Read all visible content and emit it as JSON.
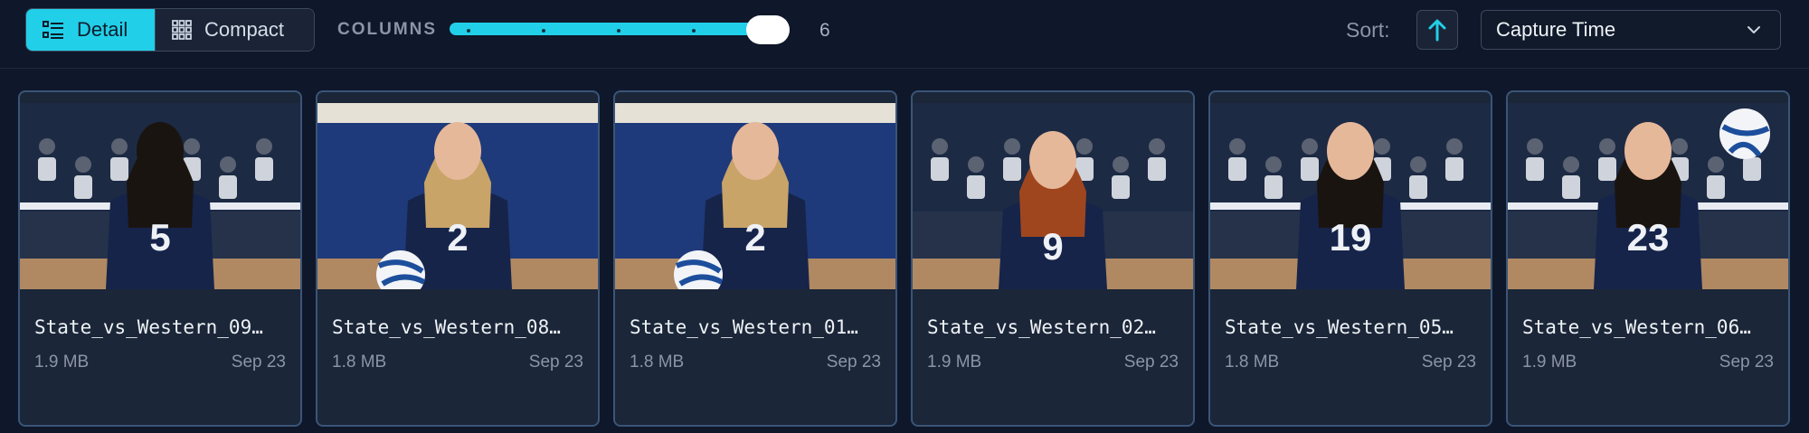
{
  "toolbar": {
    "view_modes": [
      {
        "label": "Detail",
        "icon": "list-icon",
        "active": true
      },
      {
        "label": "Compact",
        "icon": "grid-icon",
        "active": false
      }
    ],
    "columns_label": "COLUMNS",
    "columns_value": "6",
    "columns_level": 1.0,
    "sort_label": "Sort:",
    "sort_direction_icon": "arrow-up-icon",
    "sort_field": "Capture Time",
    "accent": "#22cfe8"
  },
  "photos": [
    {
      "filename": "State_vs_Western_09…",
      "size": "1.9 MB",
      "date": "Sep 23",
      "jersey": "5",
      "pose": "back"
    },
    {
      "filename": "State_vs_Western_08…",
      "size": "1.8 MB",
      "date": "Sep 23",
      "jersey": "2",
      "pose": "ball"
    },
    {
      "filename": "State_vs_Western_01…",
      "size": "1.8 MB",
      "date": "Sep 23",
      "jersey": "2",
      "pose": "ball"
    },
    {
      "filename": "State_vs_Western_02…",
      "size": "1.9 MB",
      "date": "Sep 23",
      "jersey": "9",
      "pose": "crouch"
    },
    {
      "filename": "State_vs_Western_05…",
      "size": "1.8 MB",
      "date": "Sep 23",
      "jersey": "19",
      "pose": "stand"
    },
    {
      "filename": "State_vs_Western_06…",
      "size": "1.9 MB",
      "date": "Sep 23",
      "jersey": "23",
      "pose": "bump"
    }
  ]
}
